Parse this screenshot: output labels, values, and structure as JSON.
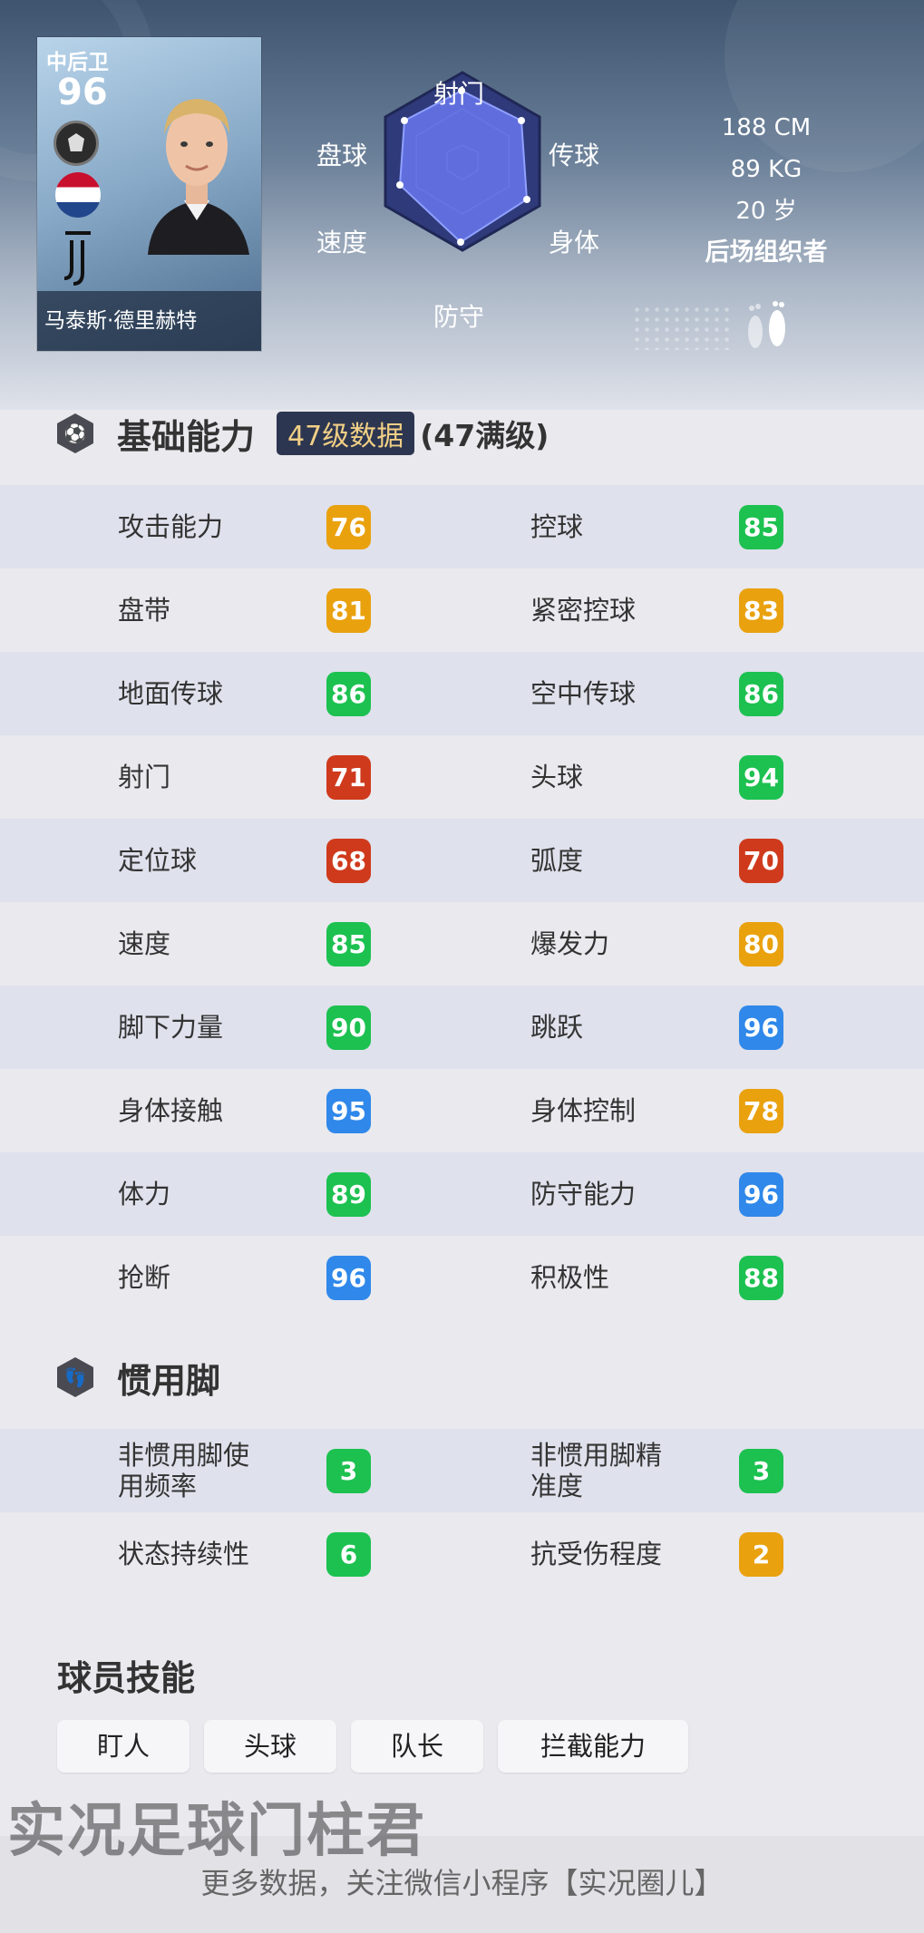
{
  "player": {
    "position": "中后卫",
    "overall": "96",
    "name": "马泰斯·德里赫特",
    "height": "188 CM",
    "weight": "89 KG",
    "age": "20 岁",
    "style": "后场组织者"
  },
  "radar": {
    "labels": [
      "射门",
      "传球",
      "身体",
      "防守",
      "速度",
      "盘球"
    ]
  },
  "base": {
    "title": "基础能力",
    "level_badge": "47级数据",
    "level_note": "(47满级)",
    "stats": [
      {
        "left_label": "攻击能力",
        "left_value": "76",
        "left_color": "#e9a10e",
        "right_label": "控球",
        "right_value": "85",
        "right_color": "#1cc150"
      },
      {
        "left_label": "盘带",
        "left_value": "81",
        "left_color": "#e9a10e",
        "right_label": "紧密控球",
        "right_value": "83",
        "right_color": "#e9a10e"
      },
      {
        "left_label": "地面传球",
        "left_value": "86",
        "left_color": "#1cc150",
        "right_label": "空中传球",
        "right_value": "86",
        "right_color": "#1cc150"
      },
      {
        "left_label": "射门",
        "left_value": "71",
        "left_color": "#cf3a1c",
        "right_label": "头球",
        "right_value": "94",
        "right_color": "#1cc150"
      },
      {
        "left_label": "定位球",
        "left_value": "68",
        "left_color": "#cf3a1c",
        "right_label": "弧度",
        "right_value": "70",
        "right_color": "#cf3a1c"
      },
      {
        "left_label": "速度",
        "left_value": "85",
        "left_color": "#1cc150",
        "right_label": "爆发力",
        "right_value": "80",
        "right_color": "#e9a10e"
      },
      {
        "left_label": "脚下力量",
        "left_value": "90",
        "left_color": "#1cc150",
        "right_label": "跳跃",
        "right_value": "96",
        "right_color": "#2f88ea"
      },
      {
        "left_label": "身体接触",
        "left_value": "95",
        "left_color": "#2f88ea",
        "right_label": "身体控制",
        "right_value": "78",
        "right_color": "#e9a10e"
      },
      {
        "left_label": "体力",
        "left_value": "89",
        "left_color": "#1cc150",
        "right_label": "防守能力",
        "right_value": "96",
        "right_color": "#2f88ea"
      },
      {
        "left_label": "抢断",
        "left_value": "96",
        "left_color": "#2f88ea",
        "right_label": "积极性",
        "right_value": "88",
        "right_color": "#1cc150"
      }
    ]
  },
  "foot": {
    "title": "惯用脚",
    "stats": [
      {
        "left_label": "非惯用脚使用频率",
        "left_value": "3",
        "left_color": "#1cc150",
        "right_label": "非惯用脚精准度",
        "right_value": "3",
        "right_color": "#1cc150"
      },
      {
        "left_label": "状态持续性",
        "left_value": "6",
        "left_color": "#1cc150",
        "right_label": "抗受伤程度",
        "right_value": "2",
        "right_color": "#e9a10e"
      }
    ]
  },
  "skills": {
    "title": "球员技能",
    "items": [
      "盯人",
      "头球",
      "队长",
      "拦截能力"
    ]
  },
  "watermark": "实况足球门柱君",
  "footer": "更多数据，关注微信小程序【实况圈儿】"
}
